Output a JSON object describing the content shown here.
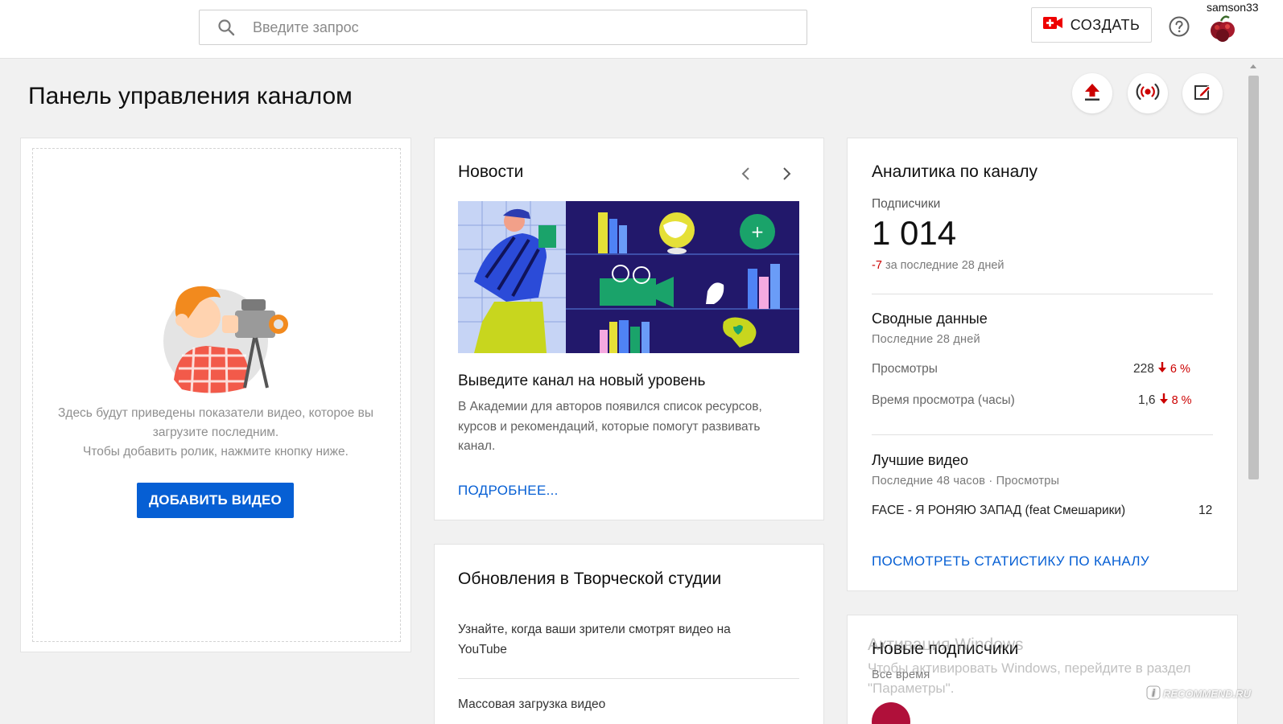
{
  "header": {
    "search_placeholder": "Введите запрос",
    "create_label": "СОЗДАТЬ",
    "username": "samson33"
  },
  "page": {
    "title": "Панель управления каналом"
  },
  "upload_card": {
    "line1": "Здесь будут приведены показатели видео, которое вы",
    "line2": "загрузите последним.",
    "line3": "Чтобы добавить ролик, нажмите кнопку ниже.",
    "button": "ДОБАВИТЬ ВИДЕО"
  },
  "news": {
    "title": "Новости",
    "heading": "Выведите канал на новый уровень",
    "body": "В Академии для авторов появился список ресурсов, курсов и рекомендаций, которые помогут развивать канал.",
    "link": "ПОДРОБНЕЕ..."
  },
  "updates": {
    "title": "Обновления в Творческой студии",
    "item1": "Узнайте, когда ваши зрители смотрят видео на YouTube",
    "item2": "Массовая загрузка видео"
  },
  "analytics": {
    "title": "Аналитика по каналу",
    "subs_label": "Подписчики",
    "subs_value": "1 014",
    "subs_change": "-7",
    "subs_period": "за последние 28 дней",
    "summary_title": "Сводные данные",
    "summary_period": "Последние 28 дней",
    "views_label": "Просмотры",
    "views_value": "228",
    "views_change": "6 %",
    "watch_label": "Время просмотра (часы)",
    "watch_value": "1,6",
    "watch_change": "8 %",
    "top_title": "Лучшие видео",
    "top_period": "Последние 48 часов · Просмотры",
    "top_video": "FACE - Я РОНЯЮ ЗАПАД (feat Смешарики)",
    "top_video_views": "12",
    "link": "ПОСМОТРЕТЬ СТАТИСТИКУ ПО КАНАЛУ"
  },
  "new_subs": {
    "title": "Новые подписчики",
    "period": "Все время"
  },
  "overlay": {
    "activation_title": "Активация Windows",
    "activation_text1": "Чтобы активировать Windows, перейдите в раздел",
    "activation_text2": "\"Параметры\".",
    "source_logo": "RECOMMEND.RU"
  },
  "colors": {
    "accent_blue": "#065fd4",
    "negative_red": "#cc0000",
    "background": "#f1f1f1"
  }
}
